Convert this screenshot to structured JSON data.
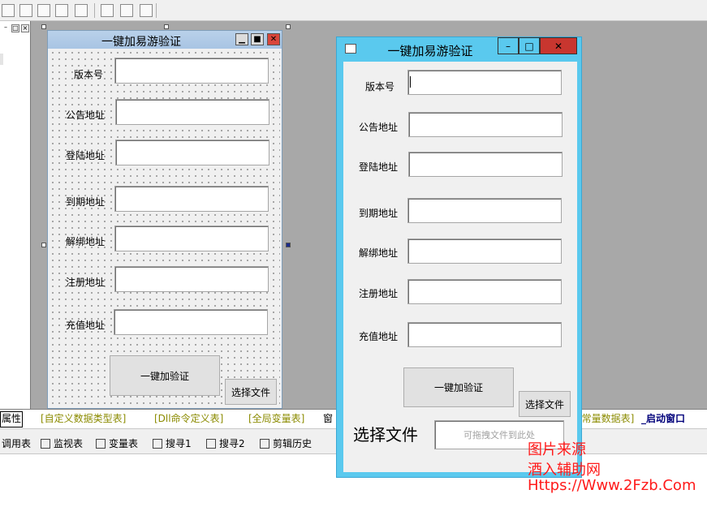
{
  "toolbar": {
    "icons": [
      "align-top-icon",
      "align-center-icon",
      "align-bottom-icon",
      "space-horizontal-icon",
      "space-vertical-icon",
      "width-icon",
      "height-icon",
      "center-icon"
    ]
  },
  "left_panel": {
    "buttons": [
      "–",
      "□",
      "×"
    ]
  },
  "design_form": {
    "title": "一键加易游验证",
    "fields": [
      {
        "label": "版本号"
      },
      {
        "label": "公告地址"
      },
      {
        "label": "登陆地址"
      },
      {
        "label": "到期地址"
      },
      {
        "label": "解绑地址"
      },
      {
        "label": "注册地址"
      },
      {
        "label": "充值地址"
      }
    ],
    "verify_button": "一键加验证",
    "choose_file_button": "选择文件"
  },
  "run_window": {
    "title": "一键加易游验证",
    "controls": {
      "minimize": "–",
      "maximize": "□",
      "close": "✕"
    },
    "fields": [
      {
        "label": "版本号",
        "value": ""
      },
      {
        "label": "公告地址",
        "value": ""
      },
      {
        "label": "登陆地址",
        "value": ""
      },
      {
        "label": "到期地址",
        "value": ""
      },
      {
        "label": "解绑地址",
        "value": ""
      },
      {
        "label": "注册地址",
        "value": ""
      },
      {
        "label": "充值地址",
        "value": ""
      }
    ],
    "verify_button": "一键加验证",
    "choose_file_button": "选择文件",
    "choose_file_label": "选择文件",
    "drop_placeholder": "可拖拽文件到此处"
  },
  "tabs": {
    "properties": "属性",
    "items": [
      "[自定义数据类型表]",
      "[Dll命令定义表]",
      "[全局变量表]",
      "窗",
      "[常量数据表]",
      "_启动窗口"
    ]
  },
  "bottom_bar": {
    "items": [
      {
        "label": "调用表",
        "icon": "call-table-icon"
      },
      {
        "label": "监视表",
        "icon": "magnifier-icon"
      },
      {
        "label": "变量表",
        "icon": "variables-icon"
      },
      {
        "label": "搜寻1",
        "icon": "search-1-icon"
      },
      {
        "label": "搜寻2",
        "icon": "search-2-icon"
      },
      {
        "label": "剪辑历史",
        "icon": "clipboard-icon"
      }
    ]
  },
  "watermark": {
    "line1": "图片来源",
    "line2": "酒入辅助网",
    "line3": "Https://Www.2Fzb.Com"
  },
  "colors": {
    "runtime_title_bg": "#5ac9ee",
    "close_button": "#c8362f",
    "watermark": "#ff1a1a"
  }
}
